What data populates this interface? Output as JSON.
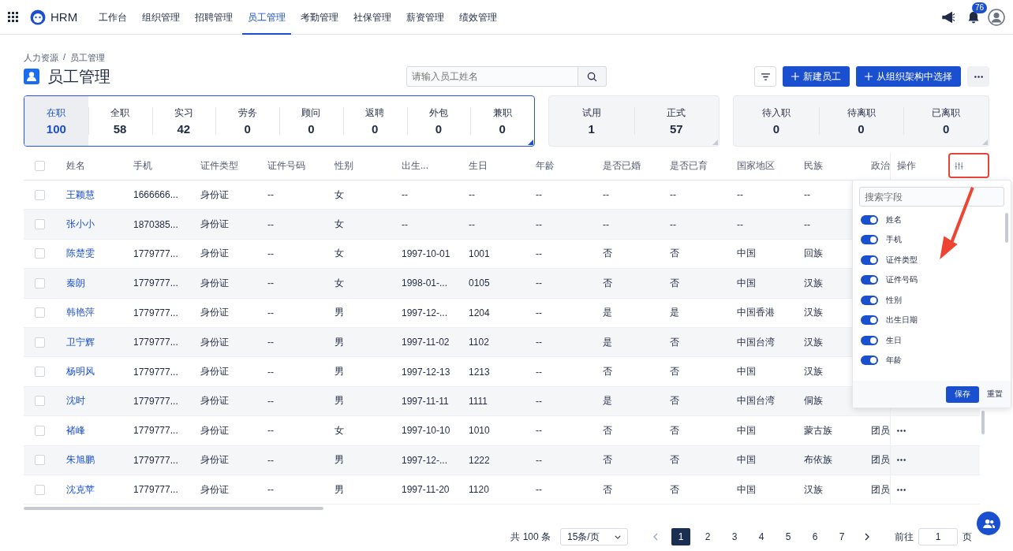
{
  "app": {
    "name": "HRM"
  },
  "nav": [
    {
      "label": "工作台",
      "selected": false
    },
    {
      "label": "组织管理",
      "selected": false
    },
    {
      "label": "招聘管理",
      "selected": false
    },
    {
      "label": "员工管理",
      "selected": true
    },
    {
      "label": "考勤管理",
      "selected": false
    },
    {
      "label": "社保管理",
      "selected": false
    },
    {
      "label": "薪资管理",
      "selected": false
    },
    {
      "label": "绩效管理",
      "selected": false
    }
  ],
  "notifications": {
    "badge": "76"
  },
  "breadcrumb": [
    "人力资源",
    "/",
    "员工管理"
  ],
  "page_title": "员工管理",
  "search": {
    "placeholder": "请输入员工姓名"
  },
  "actions": [
    "新建员工",
    "从组织架构中选择"
  ],
  "stat_groups": [
    [
      {
        "label": "在职",
        "value": "100",
        "selected": true
      },
      {
        "label": "全职",
        "value": "58",
        "selected": false
      },
      {
        "label": "实习",
        "value": "42",
        "selected": false
      },
      {
        "label": "劳务",
        "value": "0",
        "selected": false
      },
      {
        "label": "顾问",
        "value": "0",
        "selected": false
      },
      {
        "label": "返聘",
        "value": "0",
        "selected": false
      },
      {
        "label": "外包",
        "value": "0",
        "selected": false
      },
      {
        "label": "兼职",
        "value": "0",
        "selected": false
      }
    ],
    [
      {
        "label": "试用",
        "value": "1",
        "selected": false
      },
      {
        "label": "正式",
        "value": "57",
        "selected": false
      }
    ],
    [
      {
        "label": "待入职",
        "value": "0",
        "selected": false
      },
      {
        "label": "待离职",
        "value": "0",
        "selected": false
      },
      {
        "label": "已离职",
        "value": "0",
        "selected": false
      }
    ]
  ],
  "table": {
    "columns": [
      "姓名",
      "手机",
      "证件类型",
      "证件号码",
      "性别",
      "出生...",
      "生日",
      "年龄",
      "是否已婚",
      "是否已育",
      "国家地区",
      "民族",
      "政治"
    ],
    "ops_column": "操作",
    "select_all_checked": false,
    "rows": [
      {
        "checked": false,
        "cells": [
          "王颖慧",
          "1666666...",
          "身份证",
          "--",
          "女",
          "--",
          "--",
          "--",
          "--",
          "--",
          "--",
          "--",
          ""
        ]
      },
      {
        "checked": false,
        "cells": [
          "张小小",
          "1870385...",
          "身份证",
          "--",
          "女",
          "--",
          "--",
          "--",
          "--",
          "--",
          "--",
          "--",
          ""
        ]
      },
      {
        "checked": false,
        "cells": [
          "陈楚雯",
          "1779777...",
          "身份证",
          "--",
          "女",
          "1997-10-01",
          "1001",
          "--",
          "否",
          "否",
          "中国",
          "回族",
          ""
        ]
      },
      {
        "checked": false,
        "cells": [
          "秦朗",
          "1779777...",
          "身份证",
          "--",
          "女",
          "1998-01-...",
          "0105",
          "--",
          "否",
          "否",
          "中国",
          "汉族",
          ""
        ]
      },
      {
        "checked": false,
        "cells": [
          "韩艳萍",
          "1779777...",
          "身份证",
          "--",
          "男",
          "1997-12-...",
          "1204",
          "--",
          "是",
          "是",
          "中国香港",
          "汉族",
          ""
        ]
      },
      {
        "checked": false,
        "cells": [
          "卫宁辉",
          "1779777...",
          "身份证",
          "--",
          "男",
          "1997-11-02",
          "1102",
          "--",
          "是",
          "否",
          "中国台湾",
          "汉族",
          ""
        ]
      },
      {
        "checked": false,
        "cells": [
          "杨明风",
          "1779777...",
          "身份证",
          "--",
          "男",
          "1997-12-13",
          "1213",
          "--",
          "否",
          "否",
          "中国",
          "汉族",
          ""
        ]
      },
      {
        "checked": false,
        "cells": [
          "沈时",
          "1779777...",
          "身份证",
          "--",
          "男",
          "1997-11-11",
          "1111",
          "--",
          "是",
          "否",
          "中国台湾",
          "侗族",
          ""
        ]
      },
      {
        "checked": false,
        "cells": [
          "褚峰",
          "1779777...",
          "身份证",
          "--",
          "女",
          "1997-10-10",
          "1010",
          "--",
          "否",
          "否",
          "中国",
          "蒙古族",
          "团员"
        ]
      },
      {
        "checked": false,
        "cells": [
          "朱旭鹏",
          "1779777...",
          "身份证",
          "--",
          "男",
          "1997-12-...",
          "1222",
          "--",
          "否",
          "否",
          "中国",
          "布依族",
          "团员"
        ]
      },
      {
        "checked": false,
        "cells": [
          "沈克苹",
          "1779777...",
          "身份证",
          "--",
          "男",
          "1997-11-20",
          "1120",
          "--",
          "否",
          "否",
          "中国",
          "汉族",
          "团员"
        ]
      }
    ]
  },
  "column_panel": {
    "placeholder": "搜索字段",
    "fields": [
      {
        "label": "姓名",
        "on": true
      },
      {
        "label": "手机",
        "on": true
      },
      {
        "label": "证件类型",
        "on": true
      },
      {
        "label": "证件号码",
        "on": true
      },
      {
        "label": "性别",
        "on": true
      },
      {
        "label": "出生日期",
        "on": true
      },
      {
        "label": "生日",
        "on": true
      },
      {
        "label": "年龄",
        "on": true
      }
    ],
    "save": "保存",
    "reset": "重置"
  },
  "pagination": {
    "total": "共 100 条",
    "page_size": "15条/页",
    "pages": [
      {
        "label": "1",
        "selected": true
      },
      {
        "label": "2",
        "selected": false
      },
      {
        "label": "3",
        "selected": false
      },
      {
        "label": "4",
        "selected": false
      },
      {
        "label": "5",
        "selected": false
      },
      {
        "label": "6",
        "selected": false
      },
      {
        "label": "7",
        "selected": false
      }
    ],
    "goto_label": "前往",
    "goto_value": "1",
    "goto_suffix": "页"
  }
}
